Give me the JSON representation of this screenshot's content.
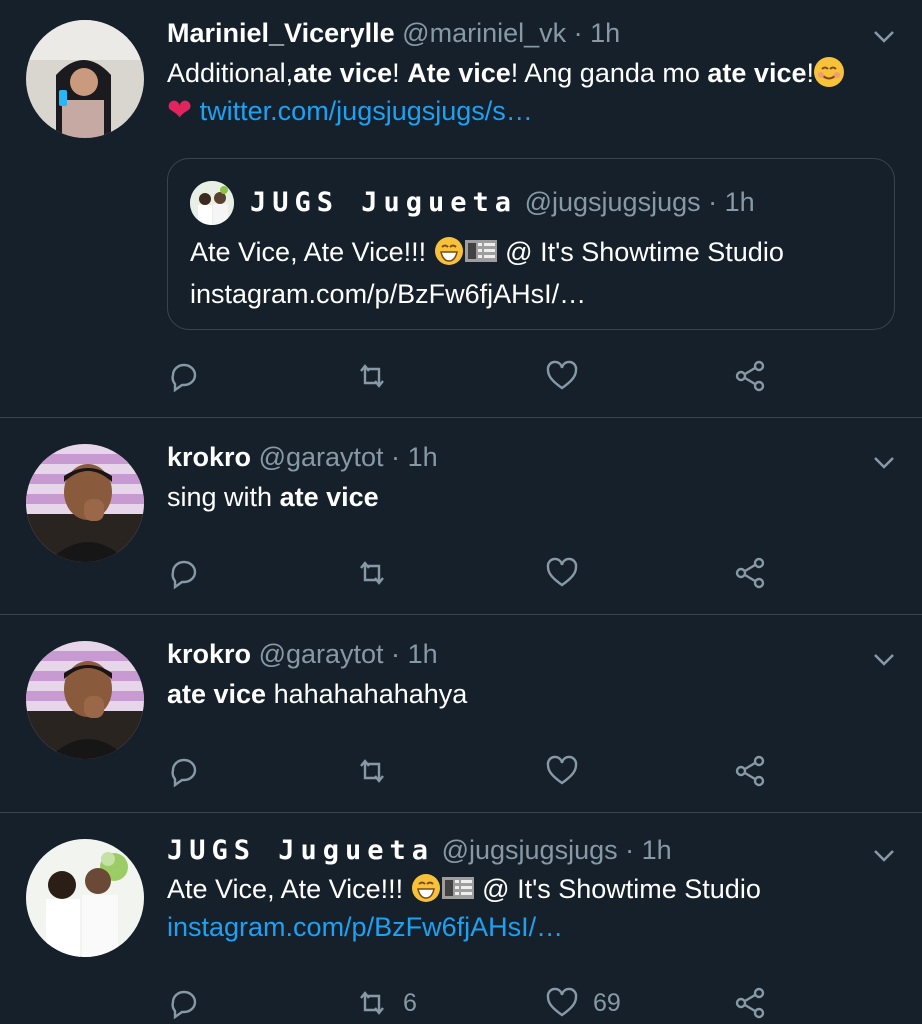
{
  "tweets": [
    {
      "name": "Mariniel_Vicerylle",
      "handle": "@mariniel_vk",
      "dot": "·",
      "time": "1h",
      "text_parts": [
        "Additional,",
        "ate vice",
        "! ",
        "Ate vice",
        "! Ang ganda mo ",
        "ate vice",
        "!"
      ],
      "link": "twitter.com/jugsjugsjugs/s…",
      "quote": {
        "name": "JUGS Jugueta",
        "handle": "@jugsjugsjugs",
        "dot": "·",
        "time": "1h",
        "text": "Ate Vice, Ate Vice!!! ",
        "text_after": " @ It's Showtime Studio",
        "link": "instagram.com/p/BzFw6fjAHsI/…"
      },
      "counts": {
        "reply": "",
        "retweet": "",
        "like": ""
      }
    },
    {
      "name": "krokro",
      "handle": "@garaytot",
      "dot": "·",
      "time": "1h",
      "text_plain": "sing with ",
      "text_bold": "ate vice",
      "counts": {
        "reply": "",
        "retweet": "",
        "like": ""
      }
    },
    {
      "name": "krokro",
      "handle": "@garaytot",
      "dot": "·",
      "time": "1h",
      "text_bold": "ate vice",
      "text_plain": " hahahahahahya",
      "counts": {
        "reply": "",
        "retweet": "",
        "like": ""
      }
    },
    {
      "name": "JUGS Jugueta",
      "handle": "@jugsjugsjugs",
      "dot": "·",
      "time": "1h",
      "text": "Ate Vice, Ate Vice!!! ",
      "text_after": " @ It's Showtime Studio",
      "link": "instagram.com/p/BzFw6fjAHsI/…",
      "counts": {
        "reply": "",
        "retweet": "6",
        "like": "69"
      }
    }
  ],
  "icons": [
    "chevron-down-icon",
    "reply-icon",
    "retweet-icon",
    "like-icon",
    "share-icon",
    "smiling-face-emoji",
    "heart-emoji",
    "grinning-face-emoji",
    "film-frames-emoji"
  ],
  "colors": {
    "background": "#15202b",
    "link": "#1da1f2",
    "muted": "#8899a6",
    "divider": "#38444d"
  }
}
